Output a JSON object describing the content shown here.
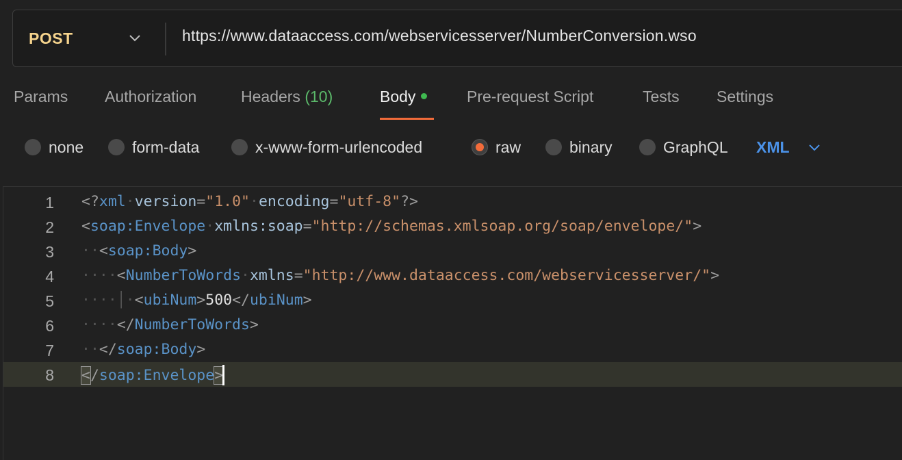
{
  "request": {
    "method": "POST",
    "url": "https://www.dataaccess.com/webservicesserver/NumberConversion.wso"
  },
  "tabs": [
    {
      "label": "Params"
    },
    {
      "label": "Authorization"
    },
    {
      "label": "Headers",
      "count": "(10)"
    },
    {
      "label": "Body",
      "active": true
    },
    {
      "label": "Pre-request Script"
    },
    {
      "label": "Tests"
    },
    {
      "label": "Settings"
    }
  ],
  "body_modes": [
    {
      "label": "none",
      "checked": false
    },
    {
      "label": "form-data",
      "checked": false
    },
    {
      "label": "x-www-form-urlencoded",
      "checked": false
    },
    {
      "label": "raw",
      "checked": true
    },
    {
      "label": "binary",
      "checked": false
    },
    {
      "label": "GraphQL",
      "checked": false
    }
  ],
  "raw_language": "XML",
  "editor": {
    "line_numbers": [
      "1",
      "2",
      "3",
      "4",
      "5",
      "6",
      "7",
      "8"
    ],
    "lines": [
      "<?xml version=\"1.0\" encoding=\"utf-8\"?>",
      "<soap:Envelope xmlns:soap=\"http://schemas.xmlsoap.org/soap/envelope/\">",
      "  <soap:Body>",
      "    <NumberToWords xmlns=\"http://www.dataaccess.com/webservicesserver/\">",
      "      <ubiNum>500</ubiNum>",
      "    </NumberToWords>",
      "  </soap:Body>",
      "</soap:Envelope>"
    ],
    "tokens": {
      "l1": {
        "xml": "xml",
        "v_attr": "version",
        "v_val": "\"1.0\"",
        "e_attr": "encoding",
        "e_val": "\"utf-8\""
      },
      "l2": {
        "tag": "soap:Envelope",
        "attr": "xmlns:soap",
        "val": "\"http://schemas.xmlsoap.org/soap/envelope/\""
      },
      "l3": {
        "tag": "soap:Body"
      },
      "l4": {
        "tag": "NumberToWords",
        "attr": "xmlns",
        "val": "\"http://www.dataaccess.com/webservicesserver/\""
      },
      "l5": {
        "tag": "ubiNum",
        "text": "500",
        "close_tag": "ubiNum"
      },
      "l6": {
        "tag": "NumberToWords"
      },
      "l7": {
        "tag": "soap:Body"
      },
      "l8": {
        "tag": "soap:Envelope"
      }
    }
  },
  "colors": {
    "method": "#f6d48d",
    "accent": "#f26b3a",
    "active_dot": "#3fb950",
    "header_count": "#5bb86a",
    "language": "#4b92e8",
    "xml_tag": "#5a93c8",
    "xml_attr": "#a8c4dc",
    "xml_string": "#c9906a"
  },
  "icons": {
    "method_dropdown": "chevron-down-icon",
    "language_dropdown": "chevron-down-icon"
  }
}
